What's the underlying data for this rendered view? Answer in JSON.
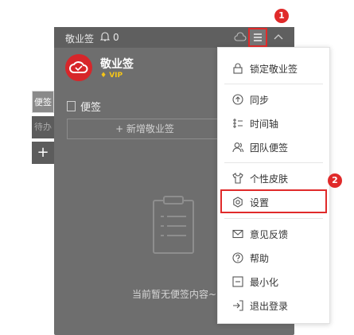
{
  "app": {
    "title": "敬业签",
    "notification_count": "0"
  },
  "user": {
    "name": "敬业签",
    "badge": "VIP"
  },
  "side_tabs": [
    "便签",
    "待办",
    "+"
  ],
  "notes": {
    "section_title": "便签",
    "add_button": "+ 新增敬业签",
    "empty_text": "当前暂无便签内容~"
  },
  "menu": {
    "items": [
      {
        "label": "锁定敬业签",
        "icon": "lock-icon"
      },
      {
        "label": "同步",
        "icon": "sync-icon"
      },
      {
        "label": "时间轴",
        "icon": "timeline-icon"
      },
      {
        "label": "团队便签",
        "icon": "team-icon"
      },
      {
        "label": "个性皮肤",
        "icon": "shirt-icon"
      },
      {
        "label": "设置",
        "icon": "settings-icon"
      },
      {
        "label": "意见反馈",
        "icon": "mail-icon"
      },
      {
        "label": "帮助",
        "icon": "help-icon"
      },
      {
        "label": "最小化",
        "icon": "minimize-icon"
      },
      {
        "label": "退出登录",
        "icon": "logout-icon"
      }
    ]
  },
  "annotations": {
    "step1": "1",
    "step2": "2"
  },
  "colors": {
    "highlight": "#e02a2a",
    "app_bg": "#6e6e6e",
    "avatar": "#d7262a",
    "vip": "#f5c518"
  }
}
